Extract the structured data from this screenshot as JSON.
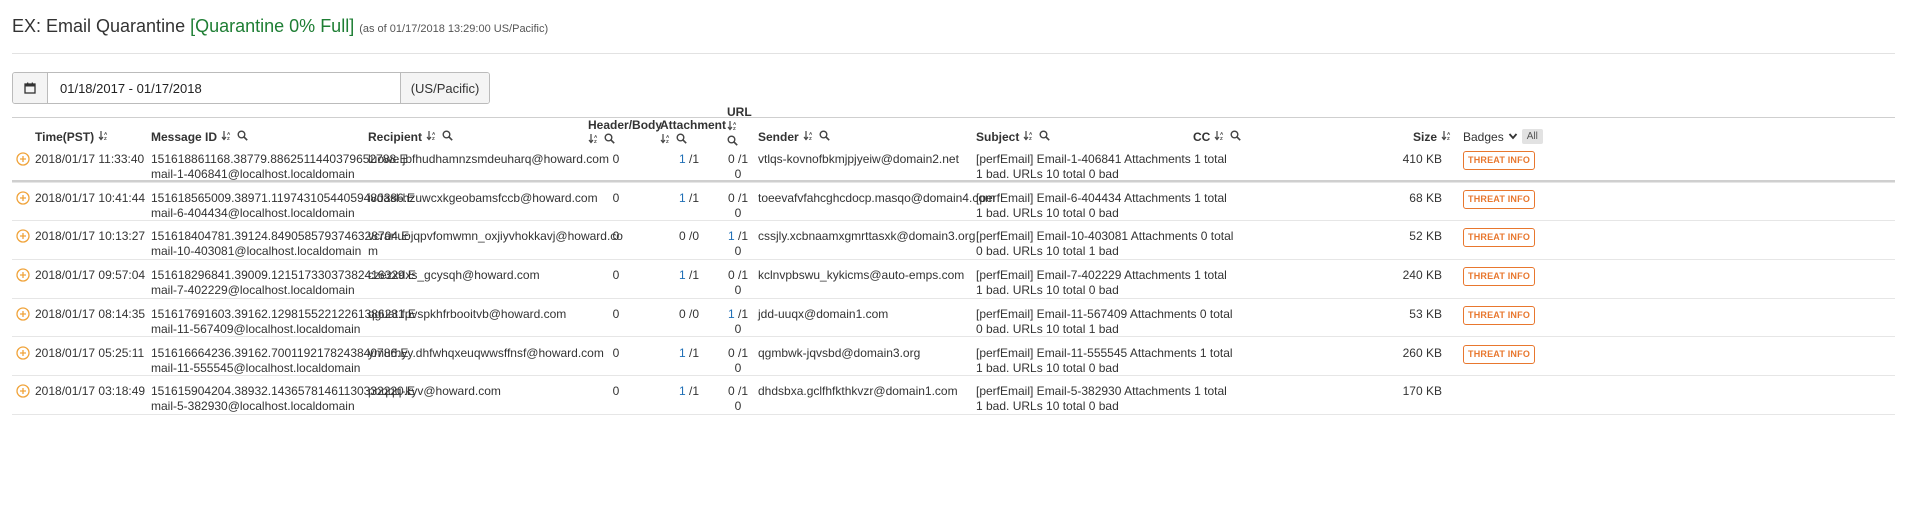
{
  "page": {
    "title": "EX: Email Quarantine",
    "status": "[Quarantine 0% Full]",
    "as_of": "(as of 01/17/2018 13:29:00 US/Pacific)"
  },
  "filter": {
    "date_range": "01/18/2017 - 01/17/2018",
    "timezone": "(US/Pacific)"
  },
  "table": {
    "headers": {
      "time": "Time(PST)",
      "message_id": "Message ID",
      "recipient": "Recipient",
      "header_body": "Header/Body",
      "attachment": "Attachment",
      "url": "URL",
      "sender": "Sender",
      "subject": "Subject",
      "cc": "CC",
      "size": "Size",
      "badges": "Badges",
      "badges_all": "All"
    },
    "rows": [
      {
        "time": "2018/01/17 11:33:40",
        "msgid1": "151618861168.38779.8862511440379652788.E",
        "msgid2": "mail-1-406841@localhost.localdomain",
        "recipient1": "luowe.jbfhudhamnzsmdeuharq@howard.com",
        "recipient2": "",
        "header_body": "0",
        "att_bad": "1",
        "att_total": "/1",
        "url_bad": "0",
        "url_total": "/1",
        "url_extra": "0",
        "sender": "vtlqs-kovnofbkmjpjyeiw@domain2.net",
        "subject1": "[perfEmail] Email-1-406841 Attachments 1 total",
        "subject2": "1 bad. URLs 10 total 0 bad",
        "cc": "",
        "size": "410 KB",
        "badge": "THREAT INFO"
      },
      {
        "time": "2018/01/17 10:41:44",
        "msgid1": "151618565009.38971.11974310544059480386.E",
        "msgid2": "mail-6-404434@localhost.localdomain",
        "recipient1": "ivdasl-hzuwcxkgeobamsfccb@howard.com",
        "recipient2": "",
        "header_body": "0",
        "att_bad": "1",
        "att_total": "/1",
        "url_bad": "0",
        "url_total": "/1",
        "url_extra": "0",
        "sender": "toeevafvfahcghcdocp.masqo@domain4.com",
        "subject1": "[perfEmail] Email-6-404434 Attachments 1 total",
        "subject2": "1 bad. URLs 10 total 0 bad",
        "cc": "",
        "size": "68 KB",
        "badge": "THREAT INFO"
      },
      {
        "time": "2018/01/17 10:13:27",
        "msgid1": "151618404781.39124.8490585793746328704.E",
        "msgid2": "mail-10-403081@localhost.localdomain",
        "recipient1": "vcranuojqpvfomwmn_oxjiyvhokkavj@howard.co",
        "recipient2": "m",
        "header_body": "0",
        "att_bad": "0",
        "att_total": "/0",
        "url_bad": "1",
        "url_total": "/1",
        "url_extra": "0",
        "sender": "cssjly.xcbnaamxgmrttasxk@domain3.org",
        "subject1": "[perfEmail] Email-10-403081 Attachments 0 total",
        "subject2": "0 bad. URLs 10 total 1 bad",
        "cc": "",
        "size": "52 KB",
        "badge": "THREAT INFO"
      },
      {
        "time": "2018/01/17 09:57:04",
        "msgid1": "151618296841.39009.12151733037382416329.E",
        "msgid2": "mail-7-402229@localhost.localdomain",
        "recipient1": "czezxdxs_gcysqh@howard.com",
        "recipient2": "",
        "header_body": "0",
        "att_bad": "1",
        "att_total": "/1",
        "url_bad": "0",
        "url_total": "/1",
        "url_extra": "0",
        "sender": "kclnvpbswu_kykicms@auto-emps.com",
        "subject1": "[perfEmail] Email-7-402229 Attachments 1 total",
        "subject2": "1 bad. URLs 10 total 0 bad",
        "cc": "",
        "size": "240 KB",
        "badge": "THREAT INFO"
      },
      {
        "time": "2018/01/17 08:14:35",
        "msgid1": "151617691603.39162.12981552212261386231.E",
        "msgid2": "mail-11-567409@localhost.localdomain",
        "recipient1": "qguat.fpvspkhfrbooitvb@howard.com",
        "recipient2": "",
        "header_body": "0",
        "att_bad": "0",
        "att_total": "/0",
        "url_bad": "1",
        "url_total": "/1",
        "url_extra": "0",
        "sender": "jdd-uuqx@domain1.com",
        "subject1": "[perfEmail] Email-11-567409 Attachments 0 total",
        "subject2": "0 bad. URLs 10 total 1 bad",
        "cc": "",
        "size": "53 KB",
        "badge": "THREAT INFO"
      },
      {
        "time": "2018/01/17 05:25:11",
        "msgid1": "151616664236.39162.7001192178243840786.E",
        "msgid2": "mail-11-555545@localhost.localdomain",
        "recipient1": "ymurhyy.dhfwhqxeuqwwsffnsf@howard.com",
        "recipient2": "",
        "header_body": "0",
        "att_bad": "1",
        "att_total": "/1",
        "url_bad": "0",
        "url_total": "/1",
        "url_extra": "0",
        "sender": "qgmbwk-jqvsbd@domain3.org",
        "subject1": "[perfEmail] Email-11-555545 Attachments 1 total",
        "subject2": "1 bad. URLs 10 total 0 bad",
        "cc": "",
        "size": "260 KB",
        "badge": "THREAT INFO"
      },
      {
        "time": "2018/01/17 03:18:49",
        "msgid1": "151615904204.38932.14365781461130332220.E",
        "msgid2": "mail-5-382930@localhost.localdomain",
        "recipient1": "poqqq-kyv@howard.com",
        "recipient2": "",
        "header_body": "0",
        "att_bad": "1",
        "att_total": "/1",
        "url_bad": "0",
        "url_total": "/1",
        "url_extra": "0",
        "sender": "dhdsbxa.gclfhfkthkvzr@domain1.com",
        "subject1": "[perfEmail] Email-5-382930 Attachments 1 total",
        "subject2": "1 bad. URLs 10 total 0 bad",
        "cc": "",
        "size": "170 KB",
        "badge": ""
      }
    ]
  },
  "colors": {
    "status_green": "#1e7e34",
    "link_blue": "#1f6fb5",
    "threat_orange": "#e8772e",
    "expand_orange": "#f0a33a"
  },
  "icons": {
    "date": "calendar-icon",
    "sort": "sort-icon",
    "search": "search-icon",
    "expand": "plus-circle-icon",
    "badges_menu": "chevron-down-icon"
  }
}
